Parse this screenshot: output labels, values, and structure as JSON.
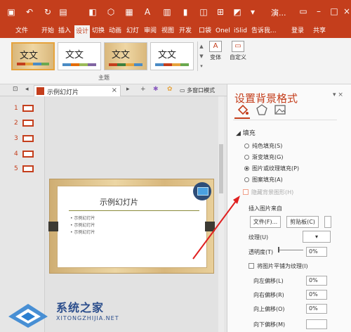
{
  "titlebar": {
    "title": "演...",
    "qa_icons": [
      "save-icon",
      "undo-icon",
      "redo-icon",
      "new-slide-icon",
      "format-icon",
      "shapes-icon",
      "table-icon",
      "screenshot-icon",
      "select-icon",
      "grid-icon",
      "customize-icon"
    ]
  },
  "tabs": [
    "文件",
    "开始",
    "插入",
    "设计",
    "切换",
    "动画",
    "幻灯",
    "审阅",
    "视图",
    "开发",
    "口袋",
    "Onel",
    "iSlid"
  ],
  "active_tab": "设计",
  "tell_me": "告诉我...",
  "login": "登录",
  "share": "共享",
  "ribbon": {
    "themes": [
      {
        "label": "文文"
      },
      {
        "label": "文文"
      },
      {
        "label": "文文"
      },
      {
        "label": "文文"
      }
    ],
    "group_label": "主题",
    "variant_label": "变体",
    "custom_label": "自定义"
  },
  "docbar": {
    "tab_label": "示例幻灯片",
    "multi_window": "多窗口模式",
    "close": "×",
    "add": "+"
  },
  "slides": [
    "1",
    "2",
    "3",
    "4",
    "5"
  ],
  "slide": {
    "title": "示例幻灯片",
    "bullets": [
      "• 示例幻灯片",
      "• 示例幻灯片",
      "• 示例幻灯片"
    ]
  },
  "pane": {
    "title": "设置背景格式",
    "section": "◢ 填充",
    "options": [
      {
        "label": "纯色填充(S)",
        "selected": false
      },
      {
        "label": "渐变填充(G)",
        "selected": false
      },
      {
        "label": "图片或纹理填充(P)",
        "selected": true
      },
      {
        "label": "图案填充(A)",
        "selected": false
      }
    ],
    "hide_bg": "隐藏背景图形(H)",
    "insert_from": "插入图片来自",
    "file_btn": "文件(F)...",
    "clipboard_btn": "剪贴板(C)",
    "texture": "纹理(U)",
    "transparency": "透明度(T)",
    "transparency_value": "0%",
    "tile": "将图片平铺为纹理(I)",
    "offset_left": "向左偏移(L)",
    "offset_right": "向右偏移(R)",
    "offset_up": "向上偏移(O)",
    "offset_down": "向下偏移(M)",
    "offset_left_value": "0%",
    "offset_right_value": "0%",
    "offset_up_value": "0%"
  },
  "watermark": {
    "text": "系统之家",
    "sub": "XITONGZHIJIA.NET"
  }
}
